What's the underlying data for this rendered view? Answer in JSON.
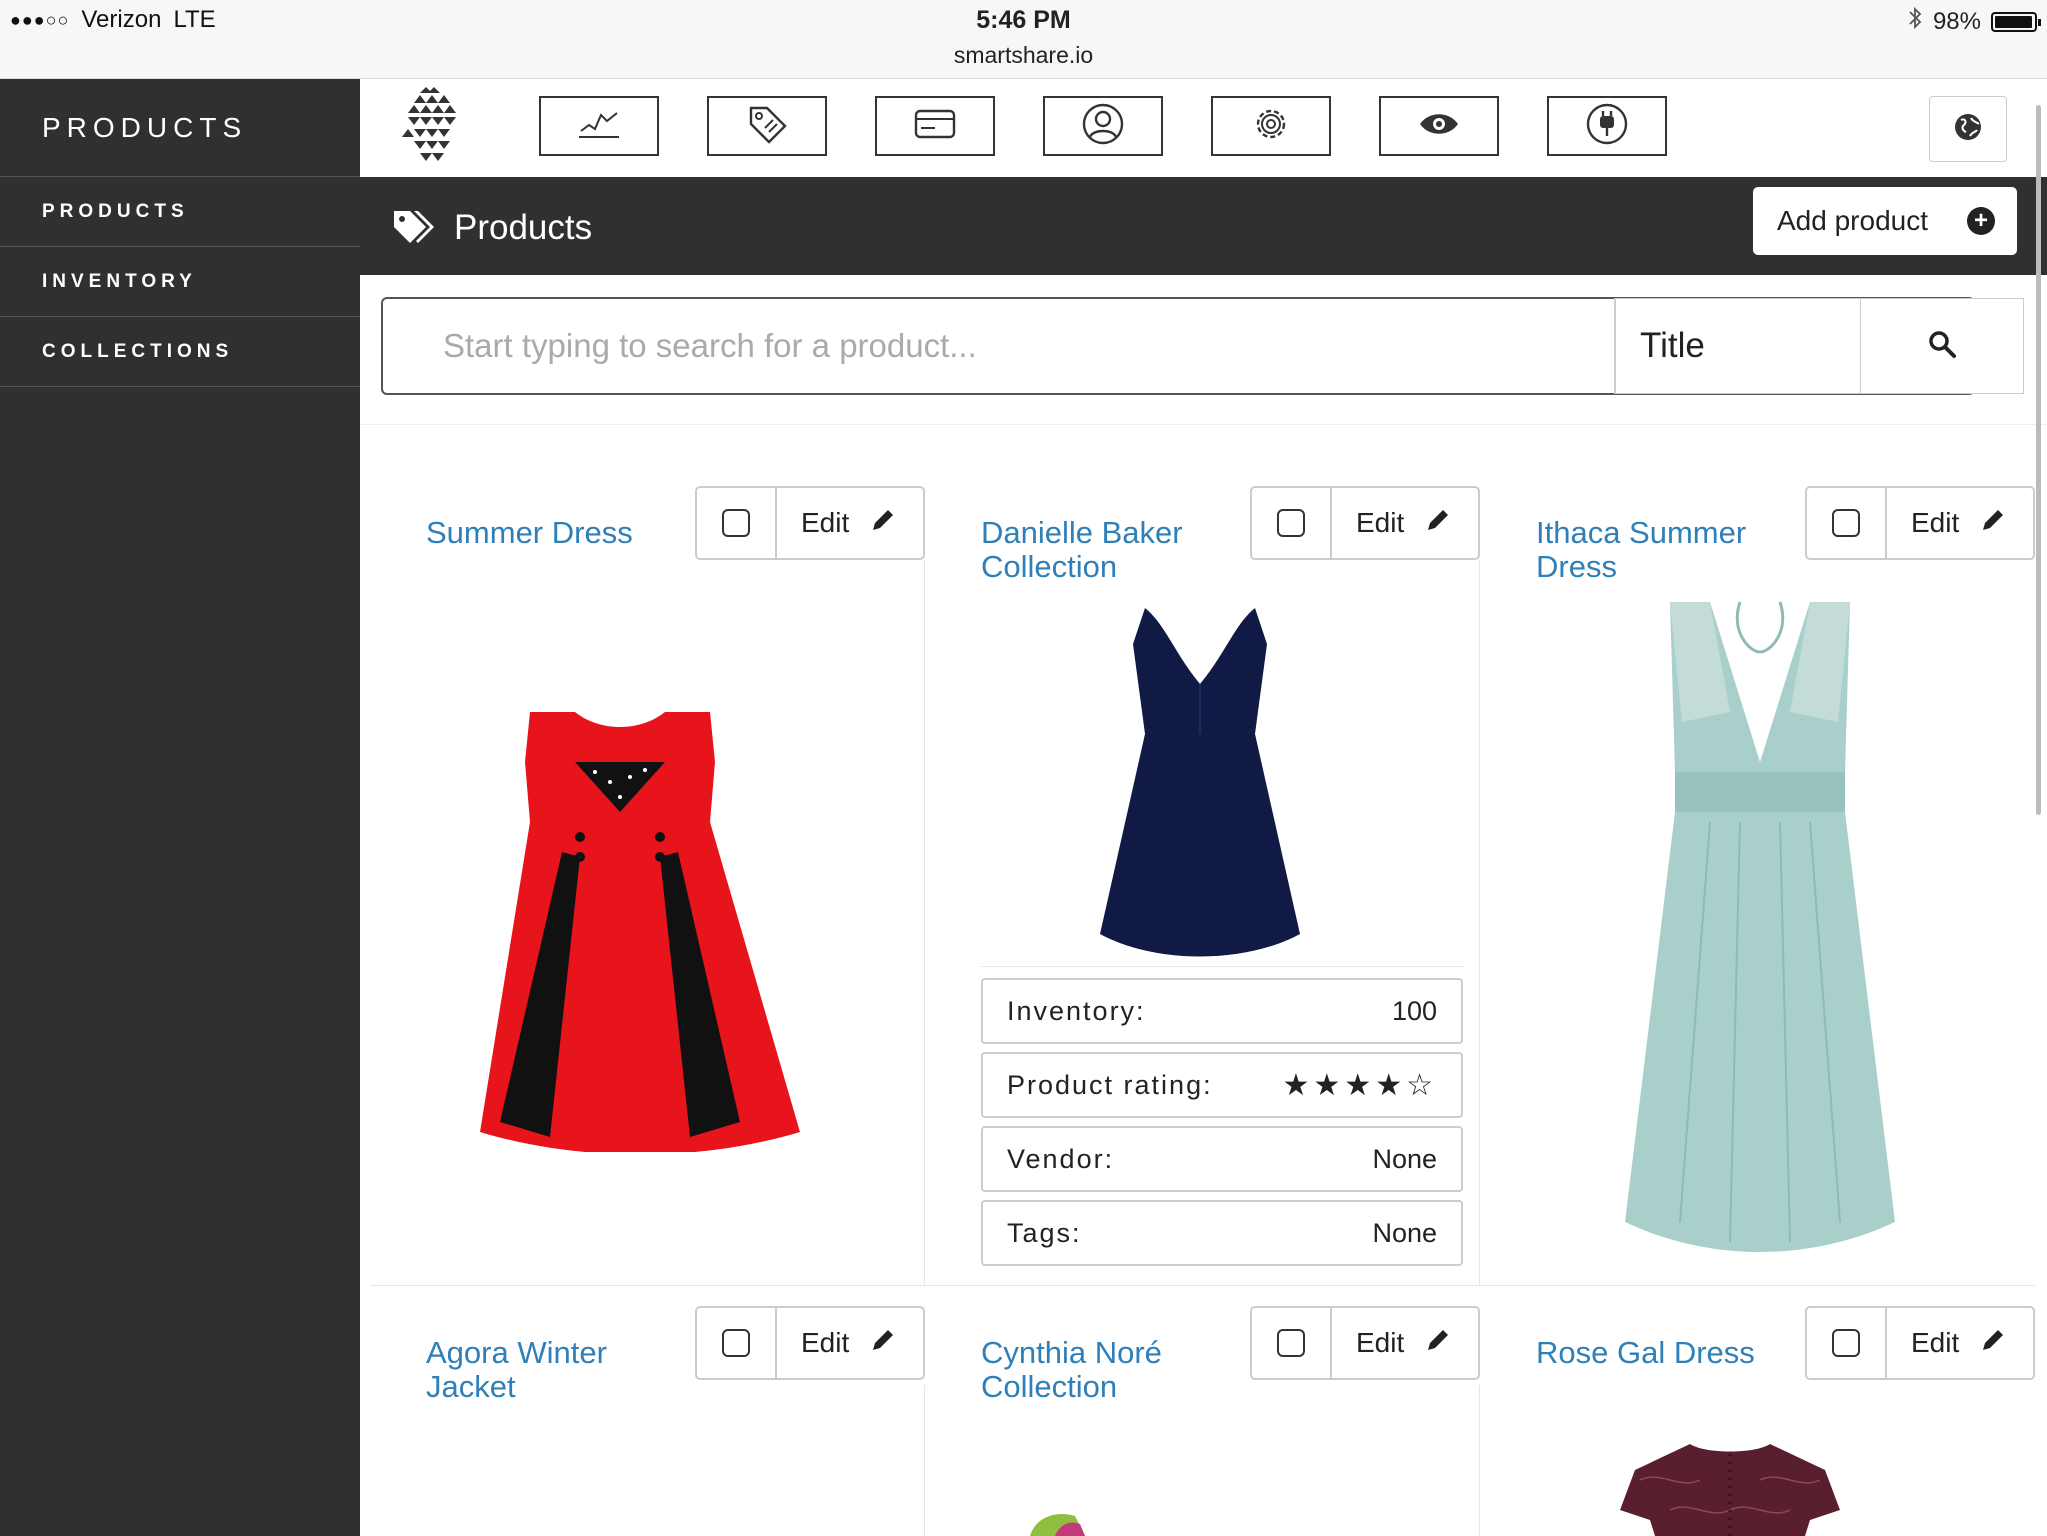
{
  "status_bar": {
    "carrier": "Verizon",
    "network": "LTE",
    "signal": "●●●○○",
    "time": "5:46 PM",
    "url": "smartshare.io",
    "battery": "98%",
    "battery_level": 0.98
  },
  "sidebar": {
    "title": "PRODUCTS",
    "items": [
      {
        "label": "PRODUCTS"
      },
      {
        "label": "INVENTORY"
      },
      {
        "label": "COLLECTIONS"
      }
    ]
  },
  "toolbar": {
    "icons": [
      "chart-icon",
      "tag-icon",
      "credit-card-icon",
      "user-icon",
      "gear-icon",
      "eye-icon",
      "power-plug-icon"
    ],
    "globe_icon": "globe-icon"
  },
  "header": {
    "title": "Products",
    "add_button_label": "Add product"
  },
  "search": {
    "placeholder": "Start typing to search for a product...",
    "field_select": "Title"
  },
  "products": [
    {
      "title": "Summer Dress",
      "edit_label": "Edit"
    },
    {
      "title": "Danielle Baker Collection",
      "edit_label": "Edit"
    },
    {
      "title": "Ithaca Summer Dress",
      "edit_label": "Edit"
    },
    {
      "title": "Agora Winter Jacket",
      "edit_label": "Edit"
    },
    {
      "title": "Cynthia Noré Collection",
      "edit_label": "Edit"
    },
    {
      "title": "Rose Gal Dress",
      "edit_label": "Edit"
    }
  ],
  "product_detail": {
    "inventory_label": "Inventory:",
    "inventory_value": "100",
    "rating_label": "Product rating:",
    "rating_stars": "★★★★☆",
    "rating_value": 4,
    "rating_max": 5,
    "vendor_label": "Vendor:",
    "vendor_value": "None",
    "tags_label": "Tags:",
    "tags_value": "None"
  },
  "colors": {
    "sidebar_bg": "#303030",
    "link": "#2f7fb8",
    "dress_red": "#e8141c",
    "dress_navy": "#101a45",
    "dress_mint": "#a9cfcb"
  }
}
